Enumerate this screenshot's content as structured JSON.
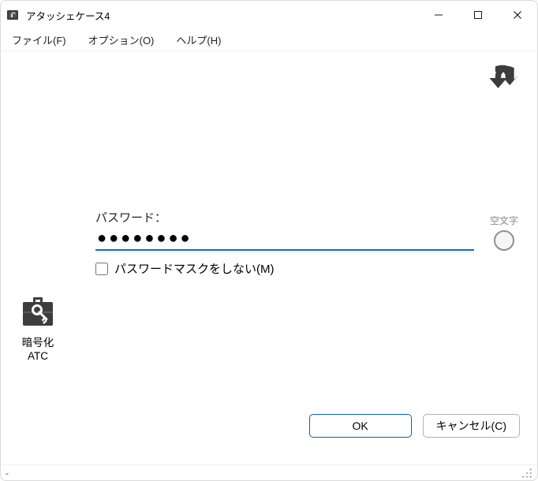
{
  "window": {
    "title": "アタッシェケース4"
  },
  "menu": {
    "file": "ファイル(F)",
    "option": "オプション(O)",
    "help": "ヘルプ(H)"
  },
  "sidebar": {
    "mode_label_line1": "暗号化",
    "mode_label_line2": "ATC"
  },
  "form": {
    "password_label": "パスワード：",
    "password_value": "●●●●●●●●",
    "empty_label": "空文字",
    "unmask_label": "パスワードマスクをしない(M)",
    "unmask_checked": false
  },
  "buttons": {
    "ok": "OK",
    "cancel": "キャンセル(C)"
  },
  "statusbar": {
    "text": "-"
  }
}
